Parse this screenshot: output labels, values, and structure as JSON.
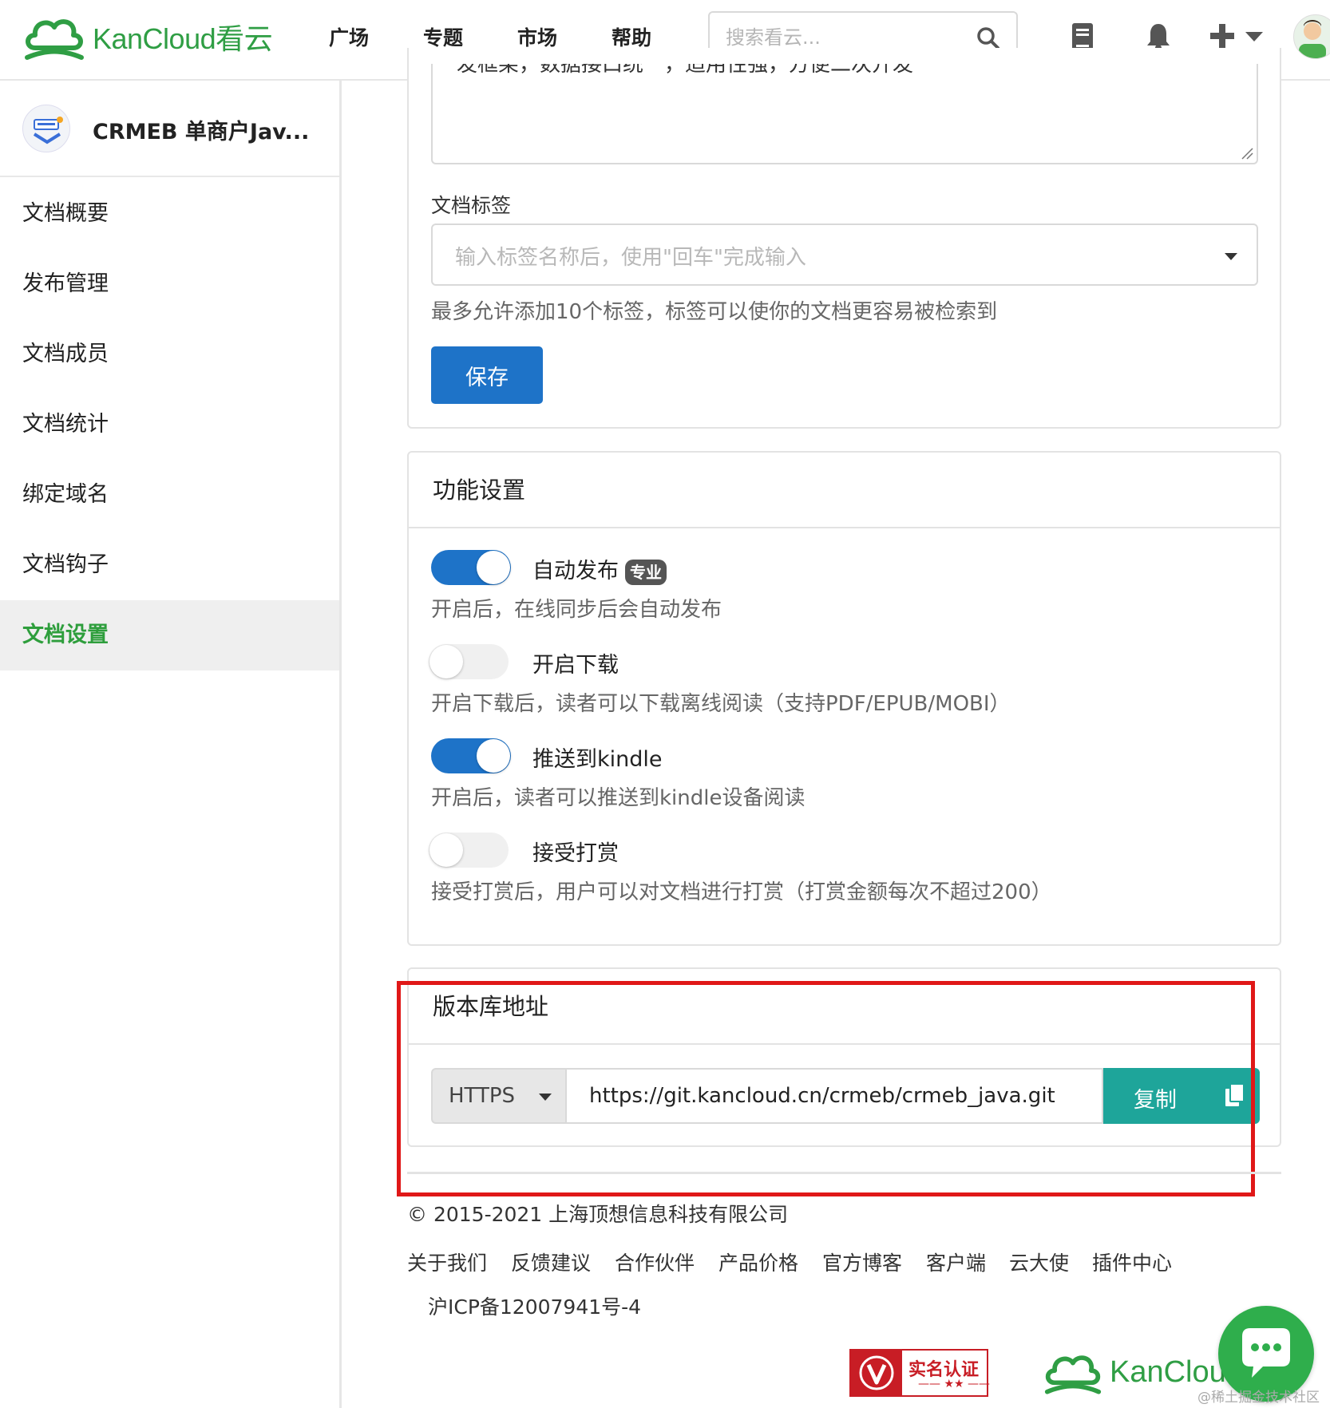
{
  "brand": {
    "name": "KanCloud",
    "name_cn": "看云",
    "color": "#2f9e44"
  },
  "nav": {
    "links": [
      "广场",
      "专题",
      "市场",
      "帮助"
    ]
  },
  "search": {
    "placeholder": "搜索看云..."
  },
  "header_icons": [
    "book-icon",
    "bell-icon",
    "plus-icon",
    "chevron-down-icon",
    "avatar"
  ],
  "sidebar": {
    "book_title": "CRMEB 单商户Jav...",
    "items": [
      "文档概要",
      "发布管理",
      "文档成员",
      "文档统计",
      "绑定域名",
      "文档钩子",
      "文档设置"
    ],
    "active_index": 6
  },
  "form": {
    "description_text": "发框架，数据接口统一，适用性强，方便二次开发",
    "tags_label": "文档标签",
    "tags_placeholder": "输入标签名称后，使用\"回车\"完成输入",
    "tags_help": "最多允许添加10个标签，标签可以使你的文档更容易被检索到",
    "save_label": "保存"
  },
  "features": {
    "title": "功能设置",
    "options": [
      {
        "label": "自动发布",
        "badge": "专业",
        "desc": "开启后，在线同步后会自动发布",
        "enabled": true
      },
      {
        "label": "开启下载",
        "desc": "开启下载后，读者可以下载离线阅读（支持PDF/EPUB/MOBI）",
        "enabled": false
      },
      {
        "label": "推送到kindle",
        "desc": "开启后，读者可以推送到kindle设备阅读",
        "enabled": true
      },
      {
        "label": "接受打赏",
        "desc": "接受打赏后，用户可以对文档进行打赏（打赏金额每次不超过200）",
        "enabled": false
      }
    ]
  },
  "repo": {
    "title": "版本库地址",
    "protocol": "HTTPS",
    "url": "https://git.kancloud.cn/crmeb/crmeb_java.git",
    "copy_label": "复制"
  },
  "footer": {
    "copyright": "© 2015-2021 上海顶想信息科技有限公司",
    "links": [
      "关于我们",
      "反馈建议",
      "合作伙伴",
      "产品价格",
      "官方博客",
      "客户端",
      "云大使",
      "插件中心"
    ],
    "icp": "沪ICP备12007941号-4",
    "verify_text": "实名认证",
    "verify_stars": "—— ★★ ——",
    "logo_text": "KanCloud"
  },
  "watermark": "@稀土掘金技术社区",
  "colors": {
    "primary": "#1e73c8",
    "teal": "#1ea59a",
    "green": "#2e9e3c",
    "highlight": "#e01818"
  }
}
